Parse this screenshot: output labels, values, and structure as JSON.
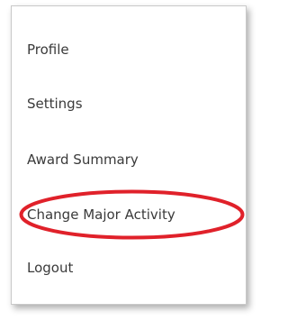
{
  "menu": {
    "items": [
      {
        "label": "Profile"
      },
      {
        "label": "Settings"
      },
      {
        "label": "Award Summary"
      },
      {
        "label": "Change Major Activity"
      },
      {
        "label": "Logout"
      }
    ]
  },
  "annotation": {
    "highlight_color": "#e0212a",
    "highlighted_item": "Change Major Activity"
  }
}
